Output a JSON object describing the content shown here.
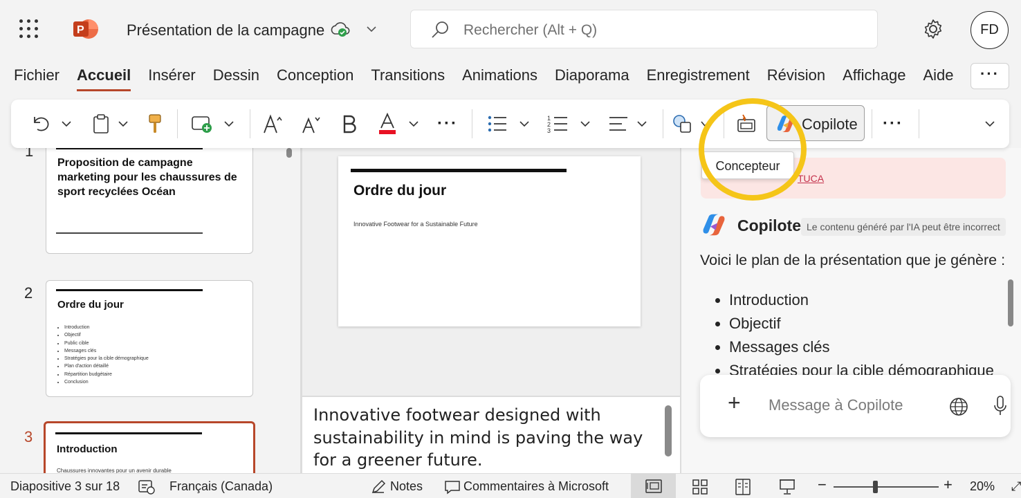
{
  "titlebar": {
    "doc_title": "Présentation de la campagne",
    "search_placeholder": "Rechercher (Alt + Q)",
    "avatar_initials": "FD"
  },
  "tabs": [
    {
      "label": "Fichier",
      "active": false
    },
    {
      "label": "Accueil",
      "active": true
    },
    {
      "label": "Insérer",
      "active": false
    },
    {
      "label": "Dessin",
      "active": false
    },
    {
      "label": "Conception",
      "active": false
    },
    {
      "label": "Transitions",
      "active": false
    },
    {
      "label": "Animations",
      "active": false
    },
    {
      "label": "Diaporama",
      "active": false
    },
    {
      "label": "Enregistrement",
      "active": false
    },
    {
      "label": "Révision",
      "active": false
    },
    {
      "label": "Affichage",
      "active": false
    },
    {
      "label": "Aide",
      "active": false
    }
  ],
  "ribbon": {
    "copilot_label": "Copilote",
    "tooltip": "Concepteur",
    "icons": [
      "undo-icon",
      "clipboard-icon",
      "format-painter-icon",
      "new-slide-icon",
      "increase-font-icon",
      "decrease-font-icon",
      "bold-icon",
      "font-color-icon",
      "bullets-icon",
      "numbering-icon",
      "align-icon",
      "shapes-icon",
      "designer-icon",
      "copilot-icon"
    ]
  },
  "thumbnails": {
    "slide1": {
      "number": "1",
      "title": "Proposition de campagne marketing pour les chaussures de sport recyclées Océan"
    },
    "slide2": {
      "number": "2",
      "title": "Ordre du jour",
      "bullets": [
        "Introduction",
        "Objectif",
        "Public cible",
        "Messages clés",
        "Stratégies pour la cible démographique",
        "Plan d'action détaillé",
        "Répartition budgétaire",
        "Conclusion"
      ]
    },
    "slide3": {
      "number": "3",
      "title": "Introduction",
      "subtitle": "Chaussures innovantes pour un avenir durable"
    }
  },
  "slide": {
    "title": "Ordre du jour",
    "subtitle": "Innovative Footwear for a Sustainable Future"
  },
  "notes": {
    "text": "Innovative footwear designed with sustainability in mind is paving the way for a greener future."
  },
  "copilot": {
    "prev_link_fragment": "TUCA",
    "name": "Copilote",
    "disclaimer": "Le contenu généré par l'IA peut être incorrect",
    "intro": "Voici le plan de la présentation que je génère :",
    "items": [
      "Introduction",
      "Objectif",
      "Messages clés",
      "Stratégies pour la cible démographique"
    ],
    "message_placeholder": "Message à Copilote"
  },
  "status": {
    "slide_count": "Diapositive 3 sur 18",
    "language": "Français (Canada)",
    "notes": "Notes",
    "comments": "Commentaires à Microsoft",
    "zoom": "20%"
  },
  "colors": {
    "accent": "#b7472a",
    "highlight_ring": "#f5c518"
  }
}
